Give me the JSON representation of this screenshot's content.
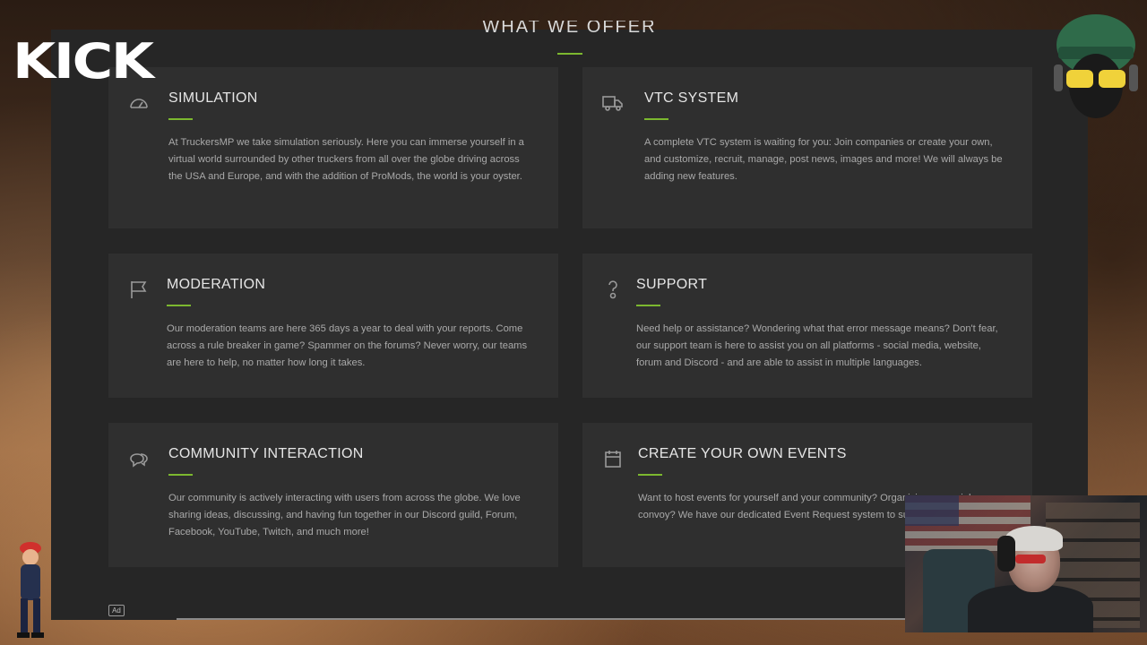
{
  "section": {
    "title": "WHAT WE OFFER"
  },
  "colors": {
    "accent": "#7cb82f",
    "card_bg": "#2f2f2f",
    "page_bg": "#262626"
  },
  "cards": [
    {
      "icon": "speedometer-icon",
      "heading": "SIMULATION",
      "body": "At TruckersMP we take simulation seriously. Here you can immerse yourself in a virtual world surrounded by other truckers from all over the globe driving across the USA and Europe, and with the addition of ProMods, the world is your oyster."
    },
    {
      "icon": "truck-icon",
      "heading": "VTC SYSTEM",
      "body": "A complete VTC system is waiting for you: Join companies or create your own, and customize, recruit, manage, post news, images and more! We will always be adding new features."
    },
    {
      "icon": "flag-icon",
      "heading": "MODERATION",
      "body": "Our moderation teams are here 365 days a year to deal with your reports. Come across a rule breaker in game? Spammer on the forums? Never worry, our teams are here to help, no matter how long it takes."
    },
    {
      "icon": "question-icon",
      "heading": "SUPPORT",
      "body": "Need help or assistance? Wondering what that error message means? Don't fear, our support team is here to assist you on all platforms - social media, website, forum and Discord - and are able to assist in multiple languages."
    },
    {
      "icon": "chat-bubbles-icon",
      "heading": "COMMUNITY INTERACTION",
      "body": "Our community is actively interacting with users from across the globe. We love sharing ideas, discussing, and having fun together in our Discord guild, Forum, Facebook, YouTube, Twitch, and much more!"
    },
    {
      "icon": "calendar-icon",
      "heading": "CREATE YOUR OWN EVENTS",
      "body": "Want to host events for yourself and your community? Organizing a special convoy? We have our dedicated Event Request system to support."
    }
  ],
  "ad": {
    "label": "Ad"
  },
  "overlay": {
    "logo_text": "KICK"
  }
}
